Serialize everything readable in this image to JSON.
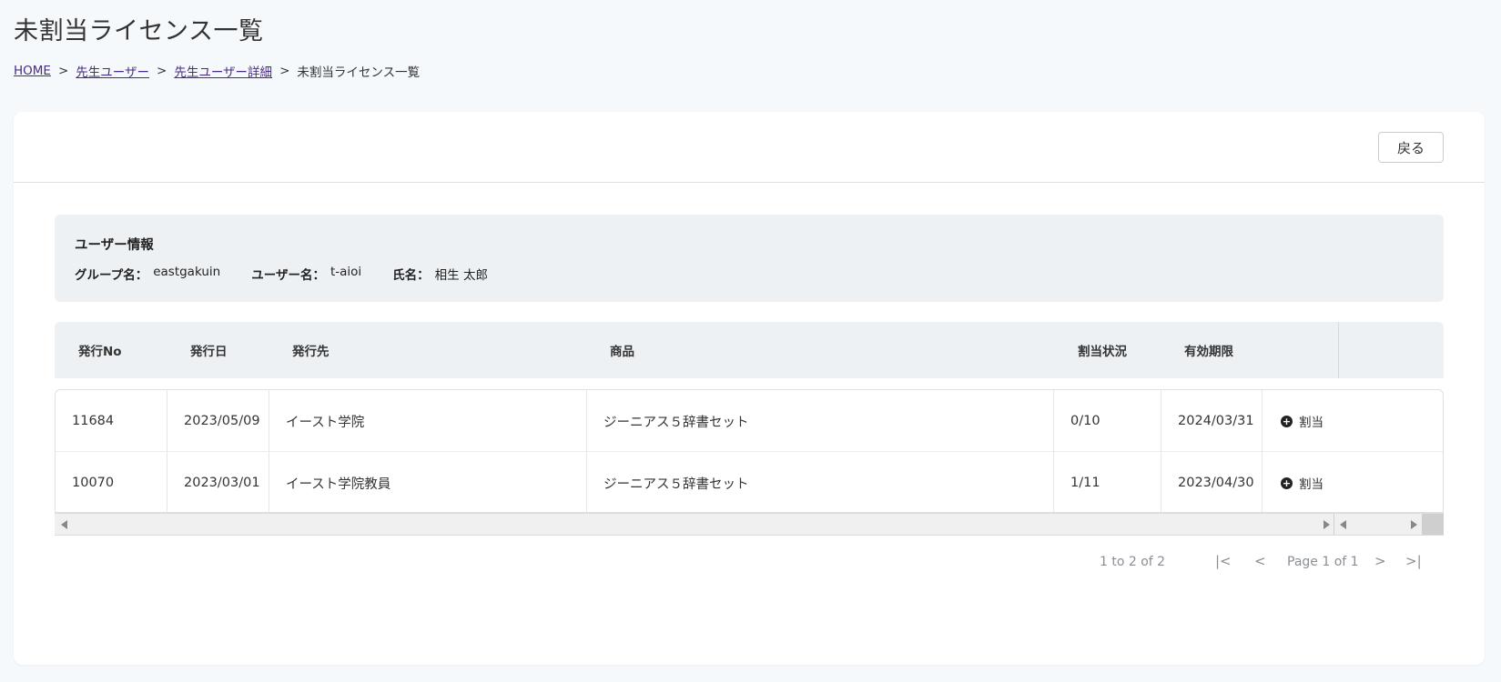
{
  "page": {
    "title": "未割当ライセンス一覧"
  },
  "breadcrumb": {
    "items": [
      {
        "label": "HOME",
        "link": true
      },
      {
        "label": "先生ユーザー",
        "link": true
      },
      {
        "label": "先生ユーザー詳細",
        "link": true
      },
      {
        "label": "未割当ライセンス一覧",
        "link": false
      }
    ],
    "separator": ">"
  },
  "toolbar": {
    "back_label": "戻る"
  },
  "user_info": {
    "title": "ユーザー情報",
    "group_label": "グループ名：",
    "group_value": "eastgakuin",
    "username_label": "ユーザー名：",
    "username_value": "t-aioi",
    "fullname_label": "氏名：",
    "fullname_value": "相生 太郎"
  },
  "grid": {
    "columns": [
      "発行No",
      "発行日",
      "発行先",
      "商品",
      "割当状況",
      "有効期限"
    ],
    "rows": [
      {
        "no": "11684",
        "date": "2023/05/09",
        "dest": "イースト学院",
        "product": "ジーニアス５辞書セット",
        "status": "0/10",
        "expiry": "2024/03/31",
        "action": "割当"
      },
      {
        "no": "10070",
        "date": "2023/03/01",
        "dest": "イースト学院教員",
        "product": "ジーニアス５辞書セット",
        "status": "1/11",
        "expiry": "2023/04/30",
        "action": "割当"
      }
    ]
  },
  "pagination": {
    "summary": "1 to 2 of 2",
    "page_label": "Page 1 of 1",
    "first_icon": "first-page-icon",
    "prev_icon": "prev-page-icon",
    "next_icon": "next-page-icon",
    "last_icon": "last-page-icon"
  },
  "colors": {
    "background": "#f6f9fc",
    "card": "#ffffff",
    "panel": "#eef1f4",
    "link": "#4b2a86"
  }
}
